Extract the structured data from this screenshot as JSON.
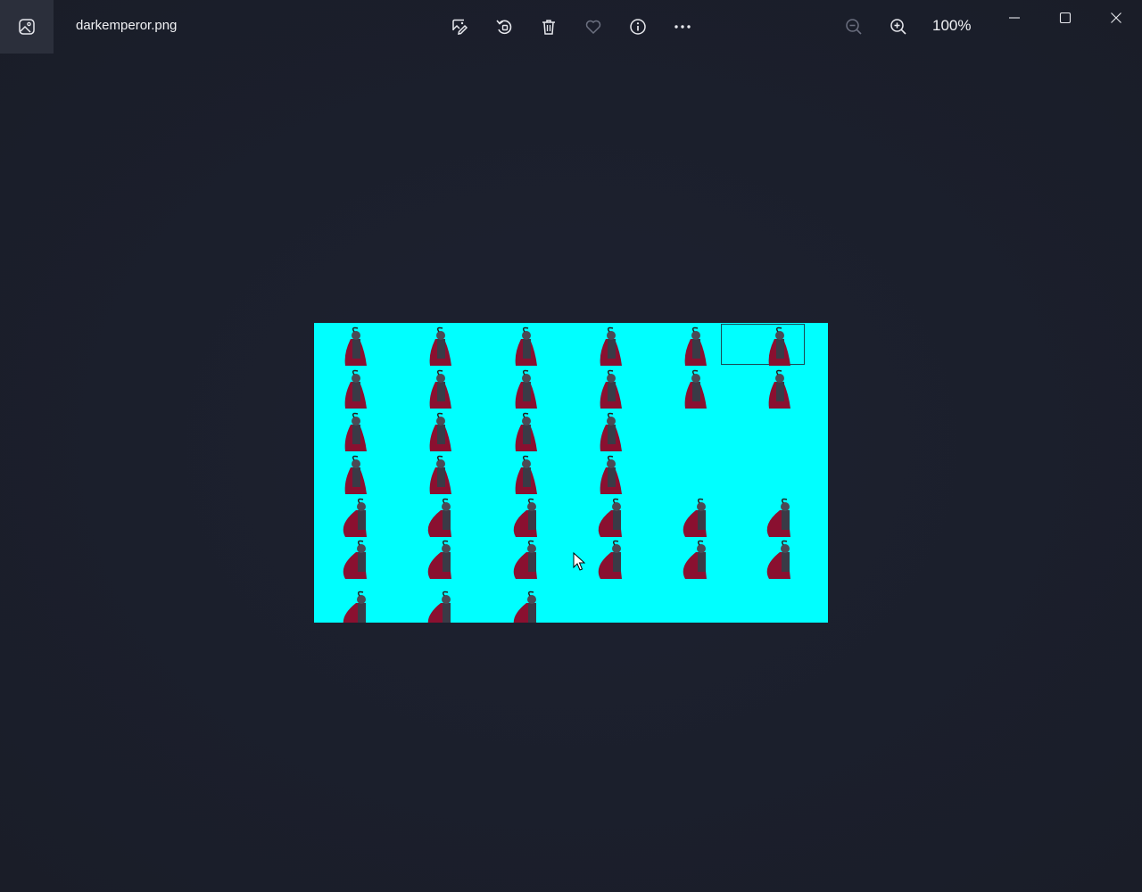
{
  "titlebar": {
    "filename": "darkemperor.png",
    "zoom_level": "100%"
  },
  "icons": {
    "app": "photo-app-icon",
    "edit": "edit-image-icon",
    "rotate": "rotate-icon",
    "delete": "trash-icon",
    "favorite": "heart-icon",
    "info": "info-icon",
    "more": "more-icon",
    "zoom_out": "zoom-out-icon",
    "zoom_in": "zoom-in-icon",
    "minimize": "minimize-icon",
    "maximize": "maximize-icon",
    "close": "close-icon"
  },
  "image": {
    "background_color": "#00ffff",
    "sprite_color": "#8a1030",
    "rows": [
      6,
      6,
      4,
      4,
      6,
      6,
      3
    ]
  },
  "colors": {
    "background": "#1c2030",
    "toolbar_icon": "#e8e9ee",
    "disabled_icon": "#6c7080"
  }
}
